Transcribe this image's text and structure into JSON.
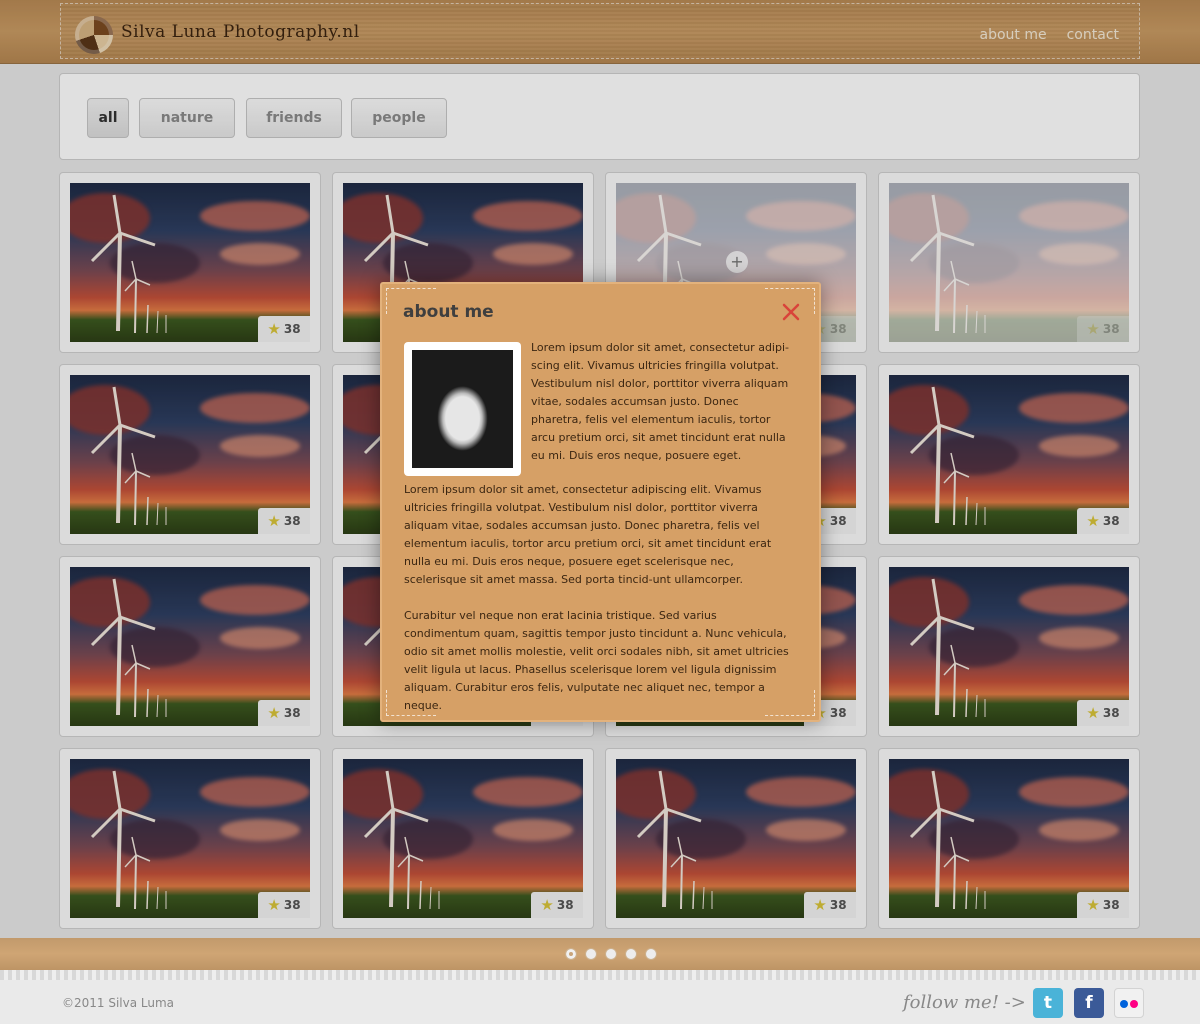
{
  "header": {
    "logo_text": "Silva Luna Photography.nl",
    "nav": [
      "about me",
      "contact"
    ]
  },
  "filters": [
    "all",
    "nature",
    "friends",
    "people"
  ],
  "active_filter": "all",
  "gallery": {
    "like_count": "38",
    "card_count": 16
  },
  "modal": {
    "title": "about me",
    "paragraph1": "Lorem ipsum dolor sit amet, consectetur adipi-scing elit. Vivamus ultricies fringilla volutpat. Vestibulum nisl dolor, porttitor viverra aliquam vitae, sodales accumsan justo. Donec pharetra, felis vel elementum iaculis, tortor arcu pretium orci, sit amet tincidunt erat nulla eu mi. Duis eros neque, posuere eget.",
    "paragraph2": "Lorem ipsum dolor sit amet, consectetur adipiscing elit. Vivamus ultricies fringilla volutpat. Vestibulum nisl dolor, porttitor viverra aliquam vitae, sodales accumsan justo. Donec pharetra, felis vel elementum iaculis, tortor arcu pretium orci, sit amet tincidunt erat nulla eu mi. Duis eros neque, posuere eget scelerisque nec, scelerisque sit amet massa. Sed porta tincid-unt ullamcorper.",
    "paragraph3": "Curabitur vel neque non erat lacinia tristique. Sed varius condimentum quam, sagittis tempor justo tincidunt a. Nunc vehicula, odio sit amet mollis molestie, velit orci sodales nibh, sit amet ultricies velit ligula ut lacus. Phasellus scelerisque lorem vel ligula dignissim aliquam. Curabitur eros felis, vulputate nec aliquet nec, tempor a neque."
  },
  "pagination": {
    "pages": 5,
    "current": 1
  },
  "footer": {
    "copyright": "©2011 Silva Luma",
    "follow": "follow me! ->",
    "social": [
      "twitter-icon",
      "facebook-icon",
      "flickr-icon"
    ]
  },
  "colors": {
    "brand": "#c99b63",
    "modal": "#d6a066",
    "star": "#d9c43a"
  }
}
